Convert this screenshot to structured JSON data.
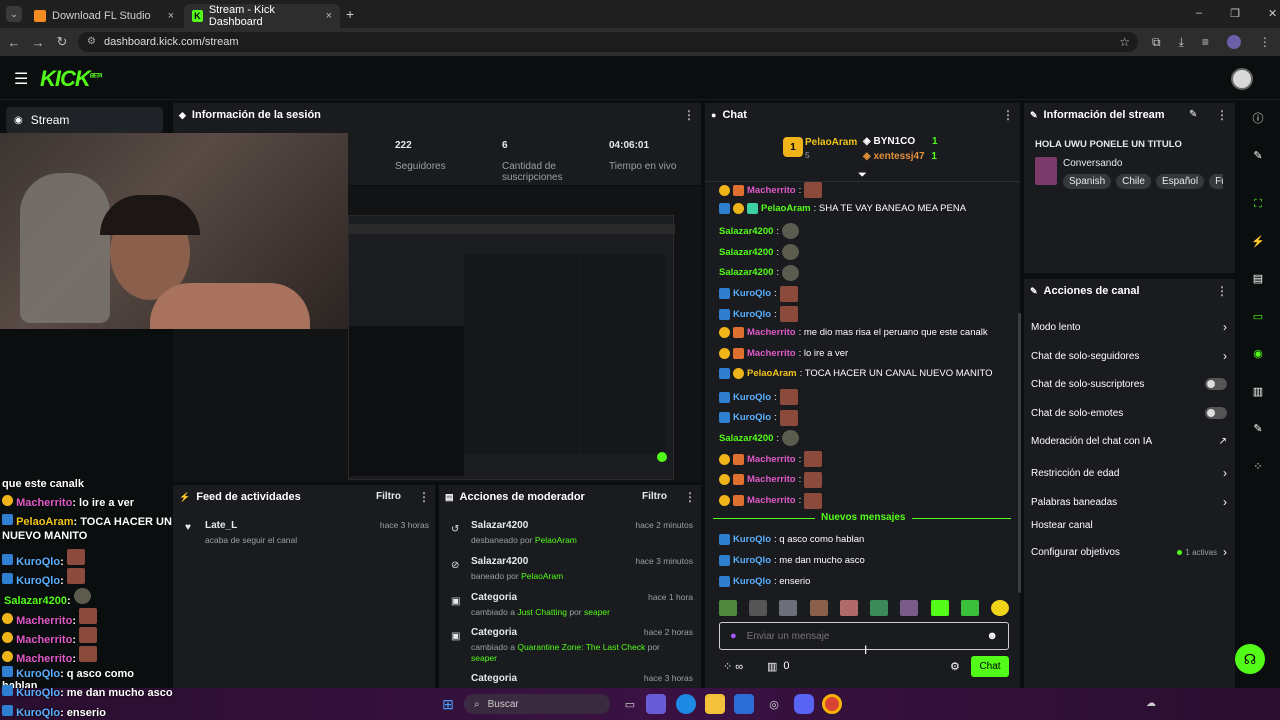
{
  "browser": {
    "tabs": [
      {
        "label": "Download FL Studio",
        "close": "×"
      },
      {
        "label": "Stream - Kick Dashboard",
        "close": "×"
      }
    ],
    "new_tab": "+",
    "url": "dashboard.kick.com/stream",
    "window_controls": [
      "–",
      "❐",
      "✕"
    ]
  },
  "header": {
    "logo": "KICK",
    "logo_sup": "BETA",
    "menu_icon": "☰"
  },
  "sidebar": {
    "label": "Stream"
  },
  "session": {
    "title": "Información de la sesión",
    "stats": [
      {
        "value": "222",
        "label": "Seguidores"
      },
      {
        "value": "6",
        "label": "Cantidad de suscripciones"
      },
      {
        "value": "04:06:01",
        "label": "Tiempo en vivo"
      }
    ]
  },
  "overlay_chat": [
    {
      "user": "",
      "text": "que este canalk"
    },
    {
      "user": "Macherrito",
      "text": ": lo ire a ver"
    },
    {
      "user": "PelaoAram",
      "text": ": TOCA HACER UN CANAL"
    },
    {
      "user": "",
      "text": "NUEVO MANITO"
    },
    {
      "user": "KuroQlo",
      "text": ":"
    },
    {
      "user": "KuroQlo",
      "text": ":"
    },
    {
      "user": "Salazar4200",
      "text": ":"
    },
    {
      "user": "Macherrito",
      "text": ":"
    },
    {
      "user": "Macherrito",
      "text": ":"
    },
    {
      "user": "Macherrito",
      "text": ":"
    },
    {
      "user": "KuroQlo",
      "text": ": q asco como hablan"
    },
    {
      "user": "KuroQlo",
      "text": ": me dan mucho asco"
    },
    {
      "user": "KuroQlo",
      "text": ": enserio"
    }
  ],
  "activity_feed": {
    "title": "Feed de actividades",
    "filter": "Filtro",
    "items": [
      {
        "user": "Late_L",
        "action": "acaba de seguir el canal",
        "time": "hace 3 horas"
      }
    ]
  },
  "mod_actions": {
    "title": "Acciones de moderador",
    "filter": "Filtro",
    "items": [
      {
        "title": "Salazar4200",
        "verb": "desbaneado por",
        "by": "PelaoAram",
        "time": "hace 2 minutos"
      },
      {
        "title": "Salazar4200",
        "verb": "baneado por",
        "by": "PelaoAram",
        "time": "hace 3 minutos"
      },
      {
        "title": "Categoria",
        "verb": "cambiado a",
        "by": "Just Chatting",
        "extra": "por",
        "by2": "seaper",
        "time": "hace 1 hora"
      },
      {
        "title": "Categoria",
        "verb": "cambiado a",
        "by": "Quarantine Zone: The Last Check",
        "extra": "por",
        "by2": "seaper",
        "time": "hace 2 horas"
      },
      {
        "title": "Categoria",
        "time": "hace 3 horas"
      }
    ]
  },
  "chat": {
    "title": "Chat",
    "leaderboard": [
      {
        "name": "PelaoAram",
        "sub": "5"
      },
      {
        "name": "BYN1CO",
        "sub": "1"
      },
      {
        "name": "xentessj47",
        "sub": "1"
      }
    ],
    "messages": [
      {
        "user": "Macherrito",
        "color": "pi",
        "text": ":",
        "badges": [
          "gold",
          "gift"
        ],
        "emote": true
      },
      {
        "user": "PelaoAram",
        "color": "gr",
        "text": ": SHA TE VAY BANEAO MEA PENA",
        "badges": [
          "kick",
          "gold",
          "sub"
        ]
      },
      {
        "user": "Salazar4200",
        "color": "gr",
        "text": ":",
        "badges": [],
        "emote": "gr"
      },
      {
        "user": "Salazar4200",
        "color": "gr",
        "text": ":",
        "badges": [],
        "emote": "gr"
      },
      {
        "user": "Salazar4200",
        "color": "gr",
        "text": ":",
        "badges": [],
        "emote": "gr"
      },
      {
        "user": "KuroQlo",
        "color": "bl",
        "text": ":",
        "badges": [
          "kick"
        ],
        "emote": true
      },
      {
        "user": "KuroQlo",
        "color": "bl",
        "text": ":",
        "badges": [
          "kick"
        ],
        "emote": true
      },
      {
        "user": "Macherrito",
        "color": "pi",
        "text": ": me dio mas risa el peruano que este canalk",
        "badges": [
          "gold",
          "gift"
        ]
      },
      {
        "user": "Macherrito",
        "color": "pi",
        "text": ": lo ire a ver",
        "badges": [
          "gold",
          "gift"
        ]
      },
      {
        "user": "PelaoAram",
        "color": "yl",
        "text": ": TOCA HACER UN CANAL NUEVO MANITO",
        "badges": [
          "kick",
          "gold"
        ]
      },
      {
        "user": "KuroQlo",
        "color": "bl",
        "text": ":",
        "badges": [
          "kick"
        ],
        "emote": true
      },
      {
        "user": "KuroQlo",
        "color": "bl",
        "text": ":",
        "badges": [
          "kick"
        ],
        "emote": true
      },
      {
        "user": "Salazar4200",
        "color": "gr",
        "text": ":",
        "badges": [],
        "emote": "gr"
      },
      {
        "user": "Macherrito",
        "color": "pi",
        "text": ":",
        "badges": [
          "gold",
          "gift"
        ],
        "emote": true
      },
      {
        "user": "Macherrito",
        "color": "pi",
        "text": ":",
        "badges": [
          "gold",
          "gift"
        ],
        "emote": true
      },
      {
        "user": "Macherrito",
        "color": "pi",
        "text": ":",
        "badges": [
          "gold",
          "gift"
        ],
        "emote": true
      }
    ],
    "new_messages_label": "Nuevos mensajes",
    "new_messages": [
      {
        "user": "KuroQlo",
        "text": ": q asco como hablan"
      },
      {
        "user": "KuroQlo",
        "text": ": me dan mucho asco"
      },
      {
        "user": "KuroQlo",
        "text": ": enserio"
      }
    ],
    "input_placeholder": "Enviar un mensaje",
    "footer_count": "0",
    "send_label": "Chat"
  },
  "stream_info": {
    "title": "Información del stream",
    "stream_title": "HOLA UWU PONELE UN TITULO",
    "category": "Conversando",
    "tags": [
      "Spanish",
      "Chile",
      "Español",
      "Fút"
    ]
  },
  "channel_actions": {
    "title": "Acciones de canal",
    "items": [
      {
        "label": "Modo lento",
        "kind": "chevron"
      },
      {
        "label": "Chat de solo-seguidores",
        "kind": "chevron"
      },
      {
        "label": "Chat de solo-suscriptores",
        "kind": "toggle"
      },
      {
        "label": "Chat de solo-emotes",
        "kind": "toggle"
      },
      {
        "label": "Moderación del chat con IA",
        "kind": "link"
      },
      {
        "label": "Restricción de edad",
        "kind": "chevron"
      },
      {
        "label": "Palabras baneadas",
        "kind": "chevron"
      },
      {
        "label": "Hostear canal",
        "kind": "none"
      },
      {
        "label": "Configurar objetivos",
        "kind": "chevron",
        "extra": "1 activas"
      }
    ]
  },
  "taskbar": {
    "search": "Buscar"
  },
  "colors": {
    "accent": "#53fc18",
    "panel": "#191b1f",
    "bg": "#0b0e0f"
  }
}
